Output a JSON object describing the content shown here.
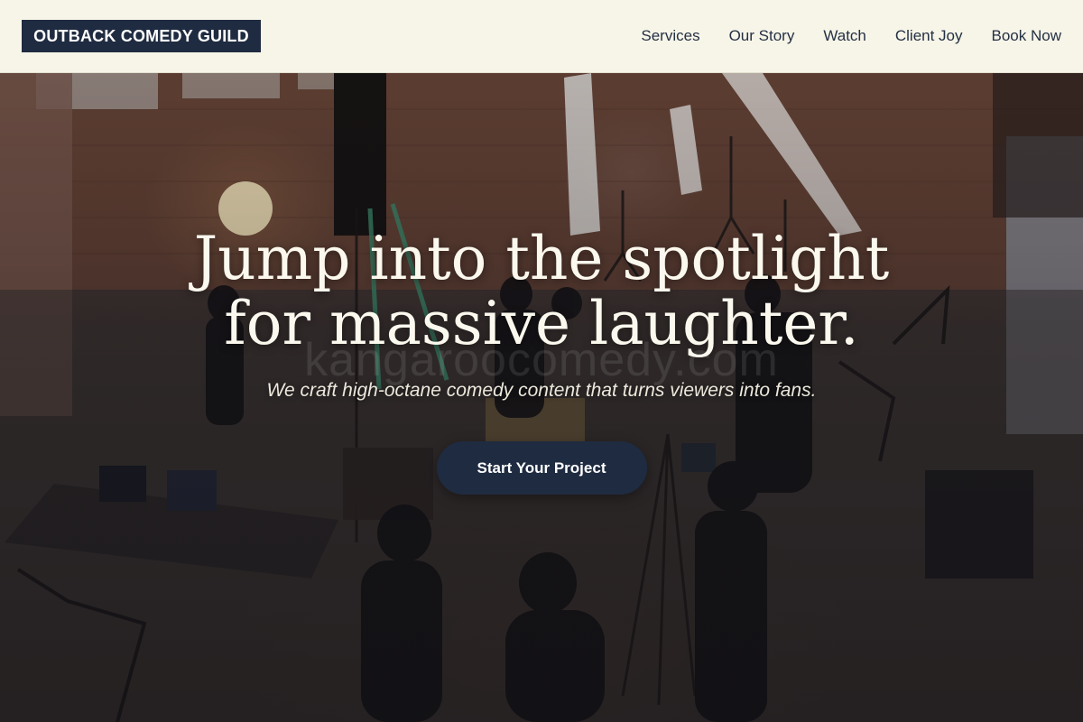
{
  "header": {
    "logo_text": "OUTBACK COMEDY GUILD",
    "nav": [
      {
        "label": "Services"
      },
      {
        "label": "Our Story"
      },
      {
        "label": "Watch"
      },
      {
        "label": "Client Joy"
      },
      {
        "label": "Book Now"
      }
    ]
  },
  "hero": {
    "headline_line1": "Jump into the spotlight",
    "headline_line2": "for massive laughter.",
    "watermark": "kangaroocomedy.com",
    "subtitle": "We craft high-octane comedy content that turns viewers into fans.",
    "cta_label": "Start Your Project",
    "background_image": "film-set-warehouse-photo"
  },
  "colors": {
    "header_bg": "#f7f5e8",
    "brand_navy": "#1f2b40",
    "headline": "#fbf8ee",
    "nav_text": "#243044"
  }
}
